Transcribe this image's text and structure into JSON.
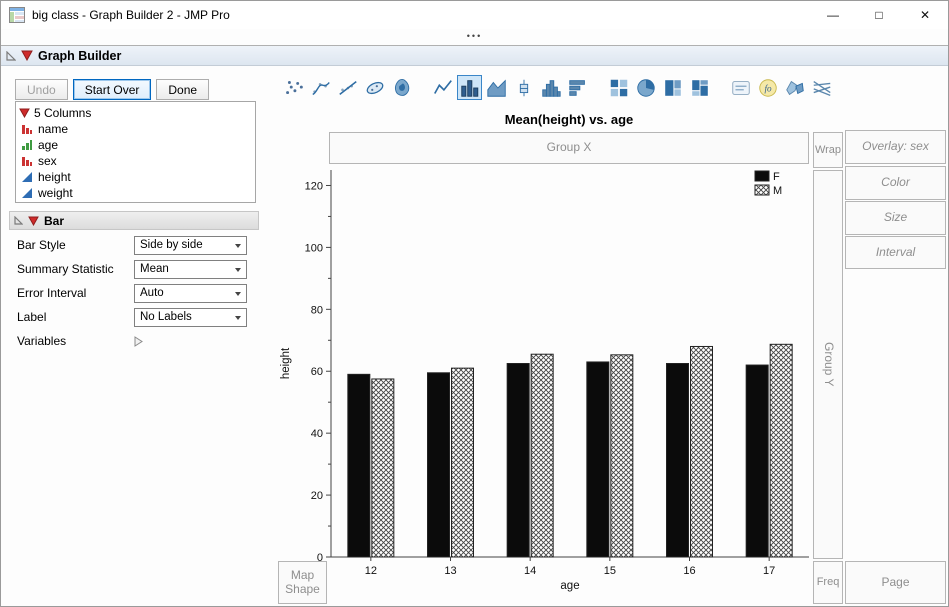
{
  "window": {
    "title": "big class - Graph Builder 2 - JMP Pro",
    "controls": {
      "minimize": "—",
      "maximize": "□",
      "close": "✕"
    },
    "grip_dots": "•••"
  },
  "outline": {
    "title": "Graph Builder"
  },
  "control_panel": {
    "buttons": [
      {
        "label": "Undo",
        "state": "disabled"
      },
      {
        "label": "Start Over",
        "state": "focused"
      },
      {
        "label": "Done",
        "state": "normal"
      }
    ],
    "columns": {
      "title": "5 Columns",
      "items": [
        {
          "label": "name",
          "type": "nominal"
        },
        {
          "label": "age",
          "type": "ordinal"
        },
        {
          "label": "sex",
          "type": "nominal"
        },
        {
          "label": "height",
          "type": "continuous"
        },
        {
          "label": "weight",
          "type": "continuous"
        }
      ]
    },
    "bar_section": {
      "title": "Bar",
      "fields": [
        {
          "label": "Bar Style",
          "value": "Side by side"
        },
        {
          "label": "Summary Statistic",
          "value": "Mean"
        },
        {
          "label": "Error Interval",
          "value": "Auto"
        },
        {
          "label": "Label",
          "value": "No Labels"
        }
      ],
      "variables_label": "Variables"
    }
  },
  "toolbar_icons": {
    "selected": "bar",
    "groups": [
      [
        "points",
        "smoother",
        "line-of-fit",
        "ellipse",
        "contour"
      ],
      [
        "line",
        "bar",
        "area",
        "box-plot",
        "histogram",
        "bar-chart"
      ],
      [
        "heatmap",
        "pie",
        "treemap",
        "mosaic"
      ],
      [
        "caption-box",
        "formula",
        "map-shapes",
        "parallel"
      ]
    ]
  },
  "drop_zones": {
    "group_x": "Group X",
    "wrap": "Wrap",
    "overlay": "Overlay: sex",
    "color": "Color",
    "size": "Size",
    "interval": "Interval",
    "group_y": "Group Y",
    "freq": "Freq",
    "page": "Page",
    "map_shape": "Map Shape"
  },
  "chart_data": {
    "type": "bar",
    "title": "Mean(height) vs. age",
    "xlabel": "age",
    "ylabel": "height",
    "ylim": [
      0,
      125
    ],
    "yticks": [
      0,
      20,
      40,
      60,
      80,
      100,
      120
    ],
    "categories": [
      "12",
      "13",
      "14",
      "15",
      "16",
      "17"
    ],
    "series": [
      {
        "name": "F",
        "fill": "solid-black",
        "values": [
          59.0,
          59.5,
          62.5,
          63.0,
          62.5,
          62.0
        ]
      },
      {
        "name": "M",
        "fill": "crosshatch",
        "values": [
          57.5,
          61.0,
          65.5,
          65.3,
          68.0,
          68.7
        ]
      }
    ],
    "legend_position": "top-right"
  }
}
